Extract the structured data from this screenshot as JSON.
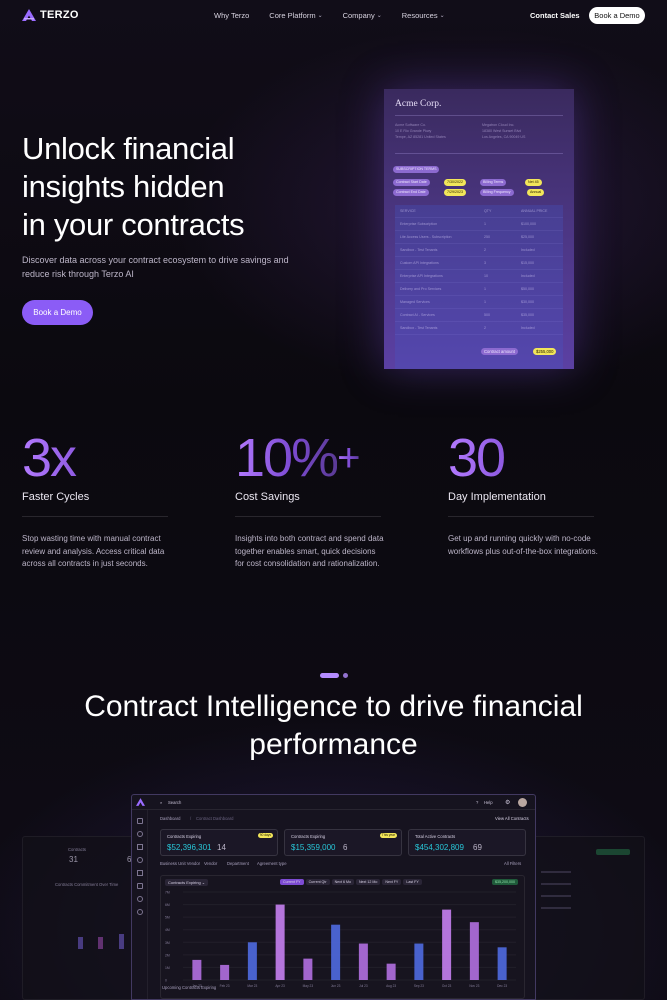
{
  "nav": {
    "logo": "TERZO",
    "links": [
      "Why Terzo",
      "Core Platform",
      "Company",
      "Resources"
    ],
    "contact": "Contact Sales",
    "demo": "Book a Demo"
  },
  "hero": {
    "title_lines": [
      "Unlock financial",
      "insights hidden",
      "in your contracts"
    ],
    "subtitle": "Discover data across your contract ecosystem to drive savings and reduce risk through Terzo AI",
    "cta": "Book a Demo"
  },
  "contract": {
    "company": "Acme Corp.",
    "party_left": [
      "Acme Software Co.",
      "10 E Rio Grande Pkwy",
      "Tempe, AZ 85281 United States"
    ],
    "party_right": [
      "Megatron Cloud Inc.",
      "18380 West Sunset Blvd",
      "Los Angeles, CA 90049 US"
    ],
    "terms_label": "SUBSCRIPTION TERMS",
    "start_label": "Contract Start Date",
    "start_value": "7/30/2022",
    "end_label": "Contract End Date",
    "end_value": "7/29/2023",
    "billing_terms_label": "Billing Terms",
    "billing_terms_value": "Net 45",
    "billing_freq_label": "Billing Frequency",
    "billing_freq_value": "Annual",
    "table_header": [
      "SERVICE",
      "QTY",
      "ANNUAL PRICE"
    ],
    "rows": [
      [
        "Enterprise Subscription",
        "1",
        "$100,000"
      ],
      [
        "Lite Access Users - Subscription",
        "250",
        "$25,000"
      ],
      [
        "Sandbox - Test Tenants",
        "2",
        "Included"
      ],
      [
        "Custom API Integrations",
        "3",
        "$15,000"
      ],
      [
        "Enterprise API Integrations",
        "10",
        "Included"
      ],
      [
        "Delivery and Pro Services",
        "1",
        "$50,000"
      ],
      [
        "Managed Services",
        "1",
        "$30,000"
      ],
      [
        "Contract AI - Services",
        "500",
        "$35,000"
      ],
      [
        "Sandbox - Test Tenants",
        "2",
        "Included"
      ]
    ],
    "amount_label": "Contract amount",
    "amount_value": "$255,000"
  },
  "stats": [
    {
      "num": "3x",
      "label": "Faster Cycles",
      "desc": "Stop wasting time with manual contract review and analysis. Access critical data across all contracts in just seconds."
    },
    {
      "num": "10%",
      "plus": "+",
      "label": "Cost Savings",
      "desc": "Insights into both contract and spend data together enables smart, quick decisions for cost consolidation and rationalization."
    },
    {
      "num": "30",
      "label": "Day Implementation",
      "desc": "Get up and running quickly with no-code workflows plus out-of-the-box integrations."
    }
  ],
  "section": {
    "title": "Contract Intelligence to drive financial performance"
  },
  "dashboard": {
    "search": "Search",
    "help": "Help",
    "breadcrumb": [
      "Dashboard",
      "Contract Dashboard"
    ],
    "view_all": "View All Contracts",
    "kpis": [
      {
        "label": "Contracts Expiring",
        "badge": "90 days",
        "value": "$52,396,301",
        "count": "14"
      },
      {
        "label": "Contracts Expiring",
        "badge": "This year",
        "value": "$15,359,000",
        "count": "6"
      },
      {
        "label": "Total Active Contracts",
        "value": "$454,302,809",
        "count": "69"
      }
    ],
    "filters": [
      "Business Unit Vendor",
      "Vendor",
      "Department",
      "Agreement type"
    ],
    "all_filters": "All Filters",
    "chart_select": "Contracts Expiring",
    "periods": [
      "Current FY",
      "Current Qtr",
      "Next 6 Mo",
      "Next 12 Mo",
      "Next FY",
      "Last FY"
    ],
    "total_badge": "$35,200,000",
    "bottom_label": "Upcoming Contracts Expiring"
  },
  "side_left": {
    "label1": "Contracts",
    "value1": "31",
    "value2": "6",
    "chart_title": "Contracts Commitment Over Time"
  },
  "chart_data": {
    "type": "bar",
    "categories": [
      "Jan 23",
      "Feb 23",
      "Mar 23",
      "Apr 23",
      "May 23",
      "Jun 23",
      "Jul 23",
      "Aug 23",
      "Sep 23",
      "Oct 23",
      "Nov 23",
      "Dec 23"
    ],
    "values": [
      1.6,
      1.2,
      3.0,
      6.0,
      1.7,
      4.4,
      2.9,
      1.3,
      2.9,
      5.6,
      4.6,
      2.6
    ],
    "ylim": [
      0,
      7
    ],
    "yticks": [
      "7M",
      "6M",
      "5M",
      "4M",
      "3M",
      "2M",
      "1M",
      "0"
    ],
    "colors": [
      "#b16fe0",
      "#b16fe0",
      "#4f6ae0",
      "#c57ff0",
      "#b16fe0",
      "#4f6ae0",
      "#b16fe0",
      "#b16fe0",
      "#4f6ae0",
      "#c57ff0",
      "#b16fe0",
      "#4f6ae0"
    ]
  }
}
